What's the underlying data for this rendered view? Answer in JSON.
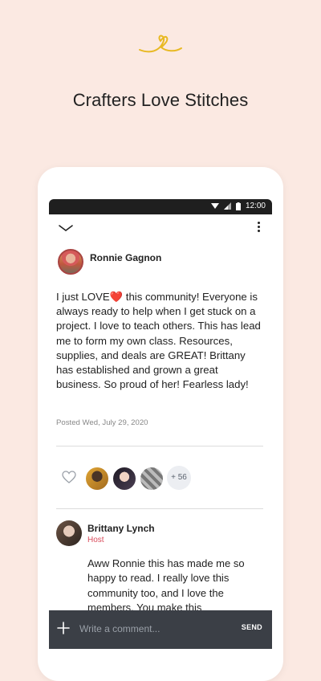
{
  "app": {
    "logo_icon": "heart-stitch-logo-icon",
    "headline": "Crafters Love Stitches"
  },
  "status_bar": {
    "time": "12:00",
    "icons": [
      "wifi-icon",
      "signal-icon",
      "battery-icon"
    ]
  },
  "toolbar": {
    "collapse_icon": "chevron-down-icon",
    "more_icon": "more-vertical-icon"
  },
  "post": {
    "author": "Ronnie Gagnon",
    "body": "I just LOVE❤️ this community! Everyone is always ready to help when I get stuck on a project. I love to teach others. This has lead me to form my own class. Resources, supplies, and deals are GREAT! Brittany has established and grown a great business. So proud of her! Fearless lady!",
    "posted": "Posted Wed, July 29, 2020",
    "like_icon": "heart-outline-icon",
    "likes_more": "+ 56"
  },
  "reply": {
    "author": "Brittany Lynch",
    "role": "Host",
    "body": "Aww Ronnie this has made me so happy to read. I really love this community too, and I love the members. You make this"
  },
  "composer": {
    "add_icon": "plus-icon",
    "placeholder": "Write a comment...",
    "send_label": "SEND"
  },
  "colors": {
    "background": "#fbe9e2",
    "logo": "#e8b923",
    "host": "#d94b5b",
    "composer": "#3b3f46"
  }
}
